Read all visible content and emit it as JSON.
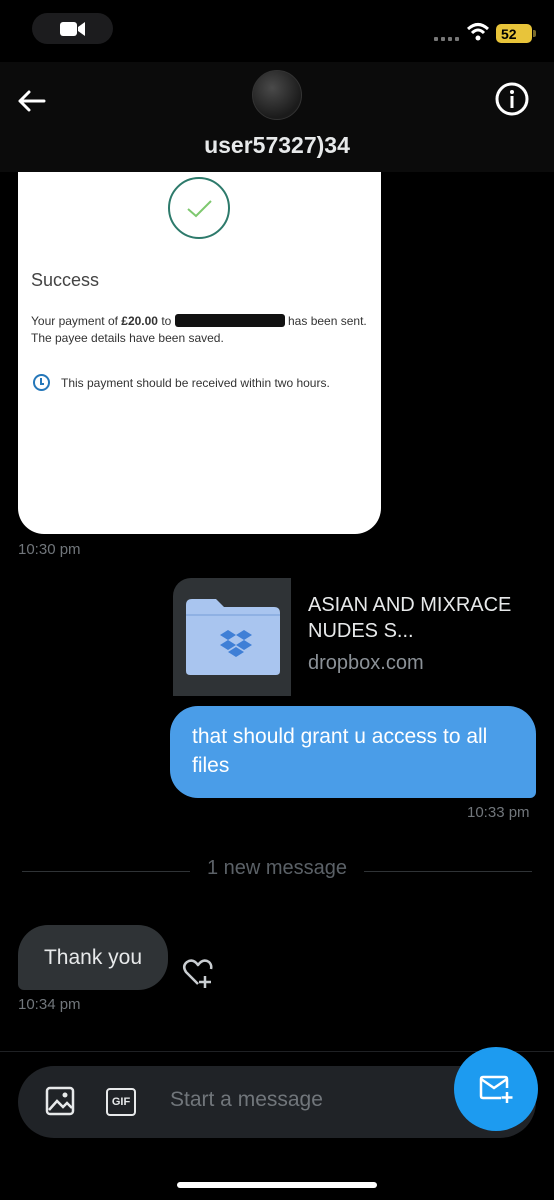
{
  "status_bar": {
    "battery": "52"
  },
  "header": {
    "username": "user57327)34"
  },
  "messages": {
    "image_receipt": {
      "title": "Success",
      "payment_prefix": "Your payment of ",
      "amount": "£20.00",
      "payment_to": " to ",
      "payment_suffix": " has been sent.",
      "payee_saved": "The payee details have been saved.",
      "receive_note": "This payment should be received within two hours.",
      "time": "10:30 pm"
    },
    "link_card": {
      "title": "ASIAN AND MIXRACE NUDES S...",
      "domain": "dropbox.com"
    },
    "outgoing": {
      "text": "that should grant u access to all files",
      "time": "10:33 pm"
    },
    "divider_label": "1 new message",
    "incoming": {
      "text": "Thank you",
      "time": "10:34 pm"
    }
  },
  "composer": {
    "placeholder": "Start a message",
    "gif_label": "GIF"
  },
  "colors": {
    "accent": "#1d9bf0",
    "outgoing_bubble": "#4a9de8",
    "incoming_bubble": "#2f3336"
  },
  "icons": [
    "video-camera-icon",
    "wifi-icon",
    "back-arrow-icon",
    "info-icon",
    "check-icon",
    "clock-icon",
    "dropbox-folder-icon",
    "heart-add-icon",
    "image-icon",
    "gif-icon",
    "new-message-icon"
  ]
}
